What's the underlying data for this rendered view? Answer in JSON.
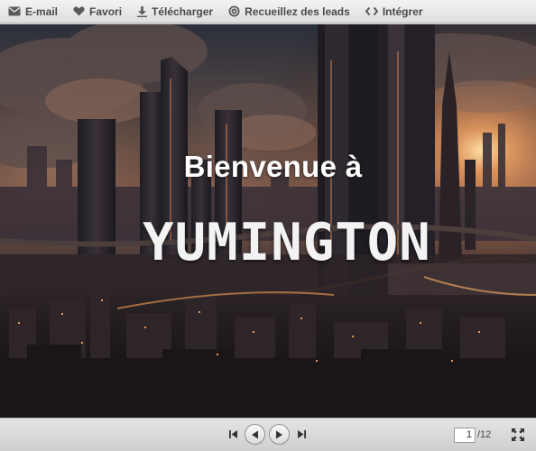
{
  "toolbar": {
    "items": [
      {
        "label": "E-mail",
        "icon": "envelope-icon"
      },
      {
        "label": "Favori",
        "icon": "heart-icon"
      },
      {
        "label": "Télécharger",
        "icon": "download-icon"
      },
      {
        "label": "Recueillez des leads",
        "icon": "leads-icon"
      },
      {
        "label": "Intégrer",
        "icon": "code-icon"
      }
    ]
  },
  "slide": {
    "welcome_text": "Bienvenue à",
    "brand_text": "YUMINGTON",
    "background": "futuristic-city-sunset-illustration"
  },
  "pagination": {
    "current_page": "1",
    "total_pages": "/12"
  },
  "colors": {
    "toolbar_text": "#4a4a4a",
    "slide_text": "#ffffff"
  }
}
